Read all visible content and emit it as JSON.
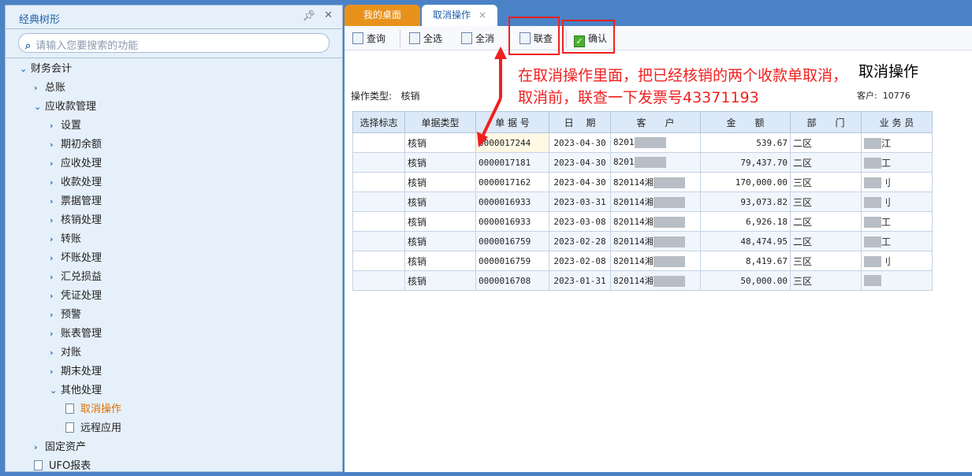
{
  "sidebar": {
    "title": "经典树形",
    "search_placeholder": "请输入您要搜索的功能",
    "items": [
      {
        "label": "财务会计",
        "level": 0,
        "expanded": true
      },
      {
        "label": "总账",
        "level": 1
      },
      {
        "label": "应收款管理",
        "level": 1,
        "expanded": true
      },
      {
        "label": "设置",
        "level": 2
      },
      {
        "label": "期初余额",
        "level": 2
      },
      {
        "label": "应收处理",
        "level": 2
      },
      {
        "label": "收款处理",
        "level": 2
      },
      {
        "label": "票据管理",
        "level": 2
      },
      {
        "label": "核销处理",
        "level": 2
      },
      {
        "label": "转账",
        "level": 2
      },
      {
        "label": "坏账处理",
        "level": 2
      },
      {
        "label": "汇兑损益",
        "level": 2
      },
      {
        "label": "凭证处理",
        "level": 2
      },
      {
        "label": "预警",
        "level": 2
      },
      {
        "label": "账表管理",
        "level": 2
      },
      {
        "label": "对账",
        "level": 2
      },
      {
        "label": "期末处理",
        "level": 2
      },
      {
        "label": "其他处理",
        "level": 2,
        "expanded": true
      },
      {
        "label": "取消操作",
        "level": 3,
        "selected": true
      },
      {
        "label": "远程应用",
        "level": 3
      },
      {
        "label": "固定资产",
        "level": 1
      },
      {
        "label": "UFO报表",
        "level": 1,
        "doc": true
      }
    ]
  },
  "tabs": [
    {
      "label": "我的桌面"
    },
    {
      "label": "取消操作",
      "close": "×"
    }
  ],
  "toolbar": {
    "query": "查询",
    "select_all": "全选",
    "deselect_all": "全消",
    "link_query": "联查",
    "confirm": "确认"
  },
  "page": {
    "title": "取消操作",
    "op_type_label": "操作类型:",
    "op_type_value": "核销",
    "customer_label": "客户:",
    "customer_value": "10776"
  },
  "annotation": {
    "line1": "在取消操作里面，把已经核销的两个收款单取消，",
    "line2": "取消前，联查一下发票号43371193"
  },
  "table": {
    "headers": [
      "选择标志",
      "单据类型",
      "单 据 号",
      "日　 期",
      "客　　户",
      "金　　额",
      "部　　门",
      "业 务 员"
    ],
    "rows": [
      [
        "",
        "核销",
        "0000017244",
        "2023-04-30",
        "8201",
        "539.67",
        "二区",
        "江"
      ],
      [
        "",
        "核销",
        "0000017181",
        "2023-04-30",
        "8201",
        "79,437.70",
        "二区",
        "工"
      ],
      [
        "",
        "核销",
        "0000017162",
        "2023-04-30",
        "820114湘",
        "170,000.00",
        "三区",
        "刂"
      ],
      [
        "",
        "核销",
        "0000016933",
        "2023-03-31",
        "820114湘",
        "93,073.82",
        "三区",
        "刂"
      ],
      [
        "",
        "核销",
        "0000016933",
        "2023-03-08",
        "820114湘",
        "6,926.18",
        "二区",
        "工"
      ],
      [
        "",
        "核销",
        "0000016759",
        "2023-02-28",
        "820114湘",
        "48,474.95",
        "二区",
        "工"
      ],
      [
        "",
        "核销",
        "0000016759",
        "2023-02-08",
        "820114湘",
        "8,419.67",
        "三区",
        "刂"
      ],
      [
        "",
        "核销",
        "0000016708",
        "2023-01-31",
        "820114湘",
        "50,000.00",
        "三区",
        ""
      ]
    ]
  }
}
